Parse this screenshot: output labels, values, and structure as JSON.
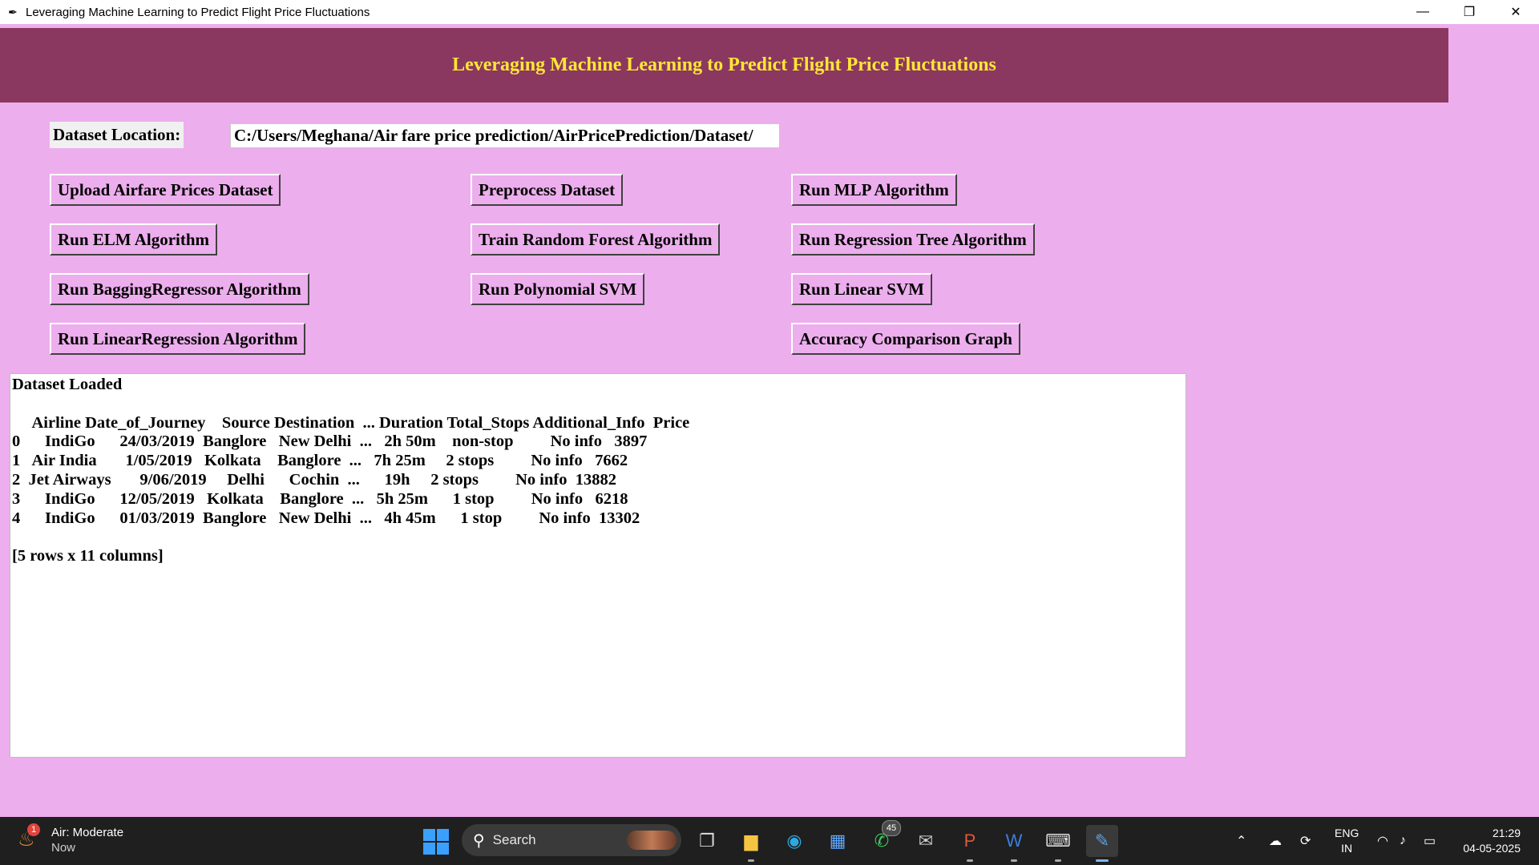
{
  "window": {
    "title": "Leveraging Machine Learning to Predict Flight Price Fluctuations",
    "minimize_glyph": "—",
    "restore_glyph": "❐",
    "close_glyph": "✕"
  },
  "header": {
    "title": "Leveraging Machine Learning to Predict Flight Price Fluctuations"
  },
  "dataset": {
    "label": "Dataset Location:",
    "path": "C:/Users/Meghana/Air fare price prediction/AirPricePrediction/Dataset/"
  },
  "buttons": {
    "upload": "Upload Airfare Prices Dataset",
    "preprocess": "Preprocess Dataset",
    "mlp": "Run MLP Algorithm",
    "elm": "Run ELM Algorithm",
    "random_forest": "Train Random Forest Algorithm",
    "regression_tree": "Run Regression Tree Algorithm",
    "bagging": "Run BaggingRegressor Algorithm",
    "poly_svm": "Run Polynomial SVM",
    "linear_svm": "Run Linear SVM",
    "linear_regression": "Run LinearRegression Algorithm",
    "accuracy_graph": "Accuracy Comparison Graph"
  },
  "output": {
    "text": "Dataset Loaded\n\n     Airline Date_of_Journey    Source Destination  ... Duration Total_Stops Additional_Info  Price\n0      IndiGo      24/03/2019  Banglore   New Delhi  ...   2h 50m    non-stop         No info   3897\n1   Air India       1/05/2019   Kolkata    Banglore  ...   7h 25m     2 stops         No info   7662\n2  Jet Airways       9/06/2019     Delhi      Cochin  ...      19h     2 stops         No info  13882\n3      IndiGo      12/05/2019   Kolkata    Banglore  ...   5h 25m      1 stop         No info   6218\n4      IndiGo      01/03/2019  Banglore   New Delhi  ...   4h 45m      1 stop         No info  13302\n\n[5 rows x 11 columns]"
  },
  "taskbar": {
    "weather_title": "Air: Moderate",
    "weather_sub": "Now",
    "weather_badge": "1",
    "search_label": "Search",
    "whatsapp_badge": "45",
    "lang_top": "ENG",
    "lang_bottom": "IN",
    "time": "21:29",
    "date": "04-05-2025"
  }
}
